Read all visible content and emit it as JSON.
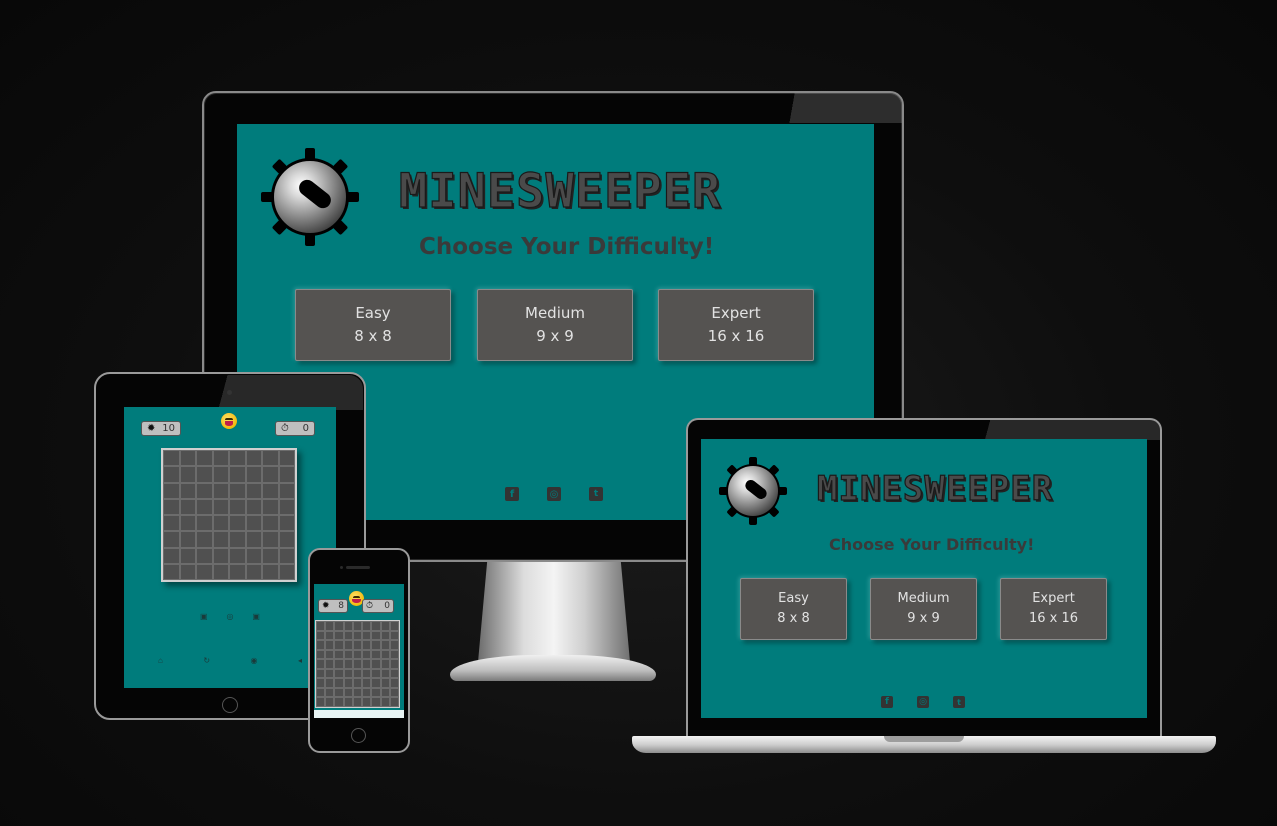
{
  "app": {
    "title": "MINESWEEPER",
    "subtitle": "Choose Your Difficulty!"
  },
  "difficulties": [
    {
      "name": "Easy",
      "size": "8 x 8"
    },
    {
      "name": "Medium",
      "size": "9 x 9"
    },
    {
      "name": "Expert",
      "size": "16 x 16"
    }
  ],
  "social_icons": [
    "facebook-icon",
    "instagram-icon",
    "twitter-icon"
  ],
  "tablet_game": {
    "mines_count": "10",
    "timer": "0",
    "grid_size": 8,
    "footer_icons": [
      "home-icon",
      "restart-icon",
      "sound-icon",
      "mute-icon"
    ]
  },
  "phone_game": {
    "mines_count": "8",
    "timer": "0",
    "grid_size": 9
  },
  "colors": {
    "background": "#0e0e0e",
    "screen_teal": "#007c7c",
    "button_gray": "#555351",
    "title_dark": "#4a4a4a"
  }
}
